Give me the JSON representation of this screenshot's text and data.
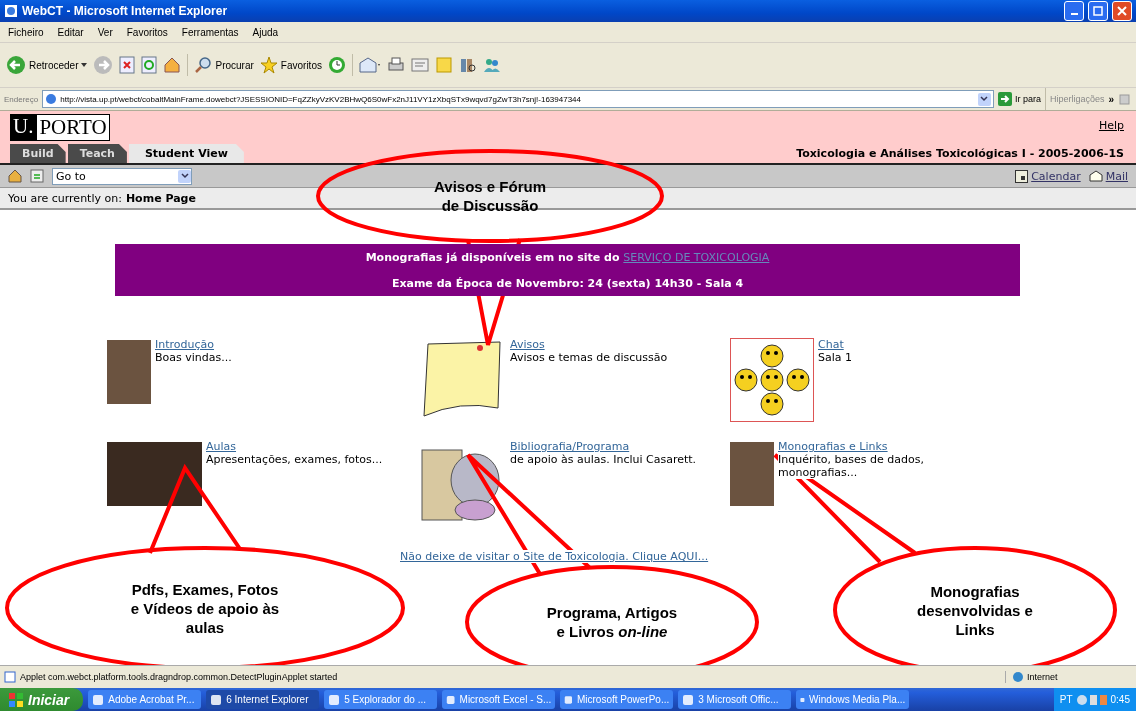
{
  "window": {
    "title": "WebCT - Microsoft Internet Explorer"
  },
  "menu": [
    "Ficheiro",
    "Editar",
    "Ver",
    "Favoritos",
    "Ferramentas",
    "Ajuda"
  ],
  "toolbar": {
    "back": "Retroceder",
    "search": "Procurar",
    "favorites": "Favoritos"
  },
  "address_bar": {
    "label": "Endereço",
    "url": "http://vista.up.pt/webct/cobaltMainFrame.dowebct?JSESSIONID=FqZZkyVzKV2BHwQ6S0wFx2nJ11VY1zXbqSTx9wqvd7gZwT3h7snj!-163947344",
    "go": "Ir para",
    "links": "Hiperligações",
    "more": "»"
  },
  "header": {
    "logo_left": "U.",
    "logo_right": "PORTO",
    "help": "Help",
    "course": "Toxicologia e Análises Toxicológicas I - 2005-2006-1S"
  },
  "tabs": [
    {
      "label": "Build",
      "selected": false
    },
    {
      "label": "Teach",
      "selected": false
    },
    {
      "label": "Student View",
      "selected": true
    }
  ],
  "nav": {
    "goto": "Go to",
    "calendar": "Calendar",
    "mail": "Mail"
  },
  "breadcrumb": {
    "label": "You are currently on:",
    "page": "Home Page"
  },
  "banner": {
    "text": "Monografias já disponíveis em no site do ",
    "link": "SERVIÇO DE TOXICOLOGIA",
    "exam": "Exame da Época de Novembro: 24 (sexta) 14h30  - Sala 4"
  },
  "items": [
    {
      "title": "Introdução",
      "desc": "Boas vindas...",
      "kind": "photo"
    },
    {
      "title": "Avisos",
      "desc": "Avisos e temas de discussão",
      "kind": "note"
    },
    {
      "title": "Chat",
      "desc": "Sala 1",
      "kind": "smileys"
    },
    {
      "title": "Aulas",
      "desc": "Apresentações, exames, fotos...",
      "kind": "painting"
    },
    {
      "title": "Bibliografia/Programa",
      "desc": "de apoio às aulas. Inclui Casarett.",
      "kind": "clipart"
    },
    {
      "title": "Monografias e Links",
      "desc": "Inquérito, bases de dados, monografias...",
      "kind": "photo"
    }
  ],
  "footer_link": "Não deixe de visitar o Site de Toxicologia. Clique AQUI...",
  "callouts": [
    {
      "lines": [
        "Avisos e Fórum",
        "de Discussão"
      ]
    },
    {
      "lines": [
        "Pdfs, Exames, Fotos",
        "e Vídeos de apoio às",
        "aulas"
      ]
    },
    {
      "lines": [
        "Programa, Artigos",
        "e Livros *on-line*"
      ]
    },
    {
      "lines": [
        "Monografias",
        "desenvolvidas e",
        "Links"
      ]
    }
  ],
  "status_bar": {
    "text": "Applet com.webct.platform.tools.dragndrop.common.DetectPluginApplet started",
    "zone": "Internet"
  },
  "taskbar": {
    "start": "Iniciar",
    "tasks": [
      {
        "label": "Adobe Acrobat Pr...",
        "selected": false
      },
      {
        "label": "6 Internet Explorer",
        "selected": true
      },
      {
        "label": "5 Explorador do ...",
        "selected": false
      },
      {
        "label": "Microsoft Excel - S...",
        "selected": false
      },
      {
        "label": "Microsoft PowerPo...",
        "selected": false
      },
      {
        "label": "3 Microsoft Offic...",
        "selected": false
      },
      {
        "label": "Windows Media Pla...",
        "selected": false
      }
    ],
    "language": "PT",
    "clock": "0:45"
  }
}
